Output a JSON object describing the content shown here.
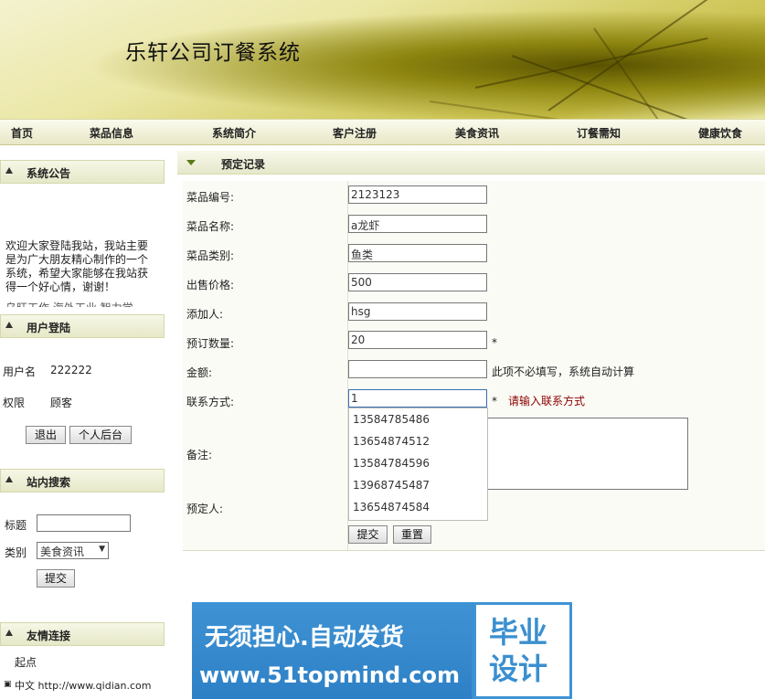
{
  "site_title": "乐轩公司订餐系统",
  "nav": [
    "首页",
    "菜品信息",
    "系统简介",
    "客户注册",
    "美食资讯",
    "订餐需知",
    "健康饮食"
  ],
  "left": {
    "notice": {
      "title": "系统公告",
      "text": "欢迎大家登陆我站，我站主要是为广大朋友精心制作的一个系统，希望大家能够在我站获得一个好心情，谢谢！",
      "cut_line": "乌旺工作   海外工业   智力学"
    },
    "login": {
      "title": "用户登陆",
      "username_label": "用户名",
      "username_value": "222222",
      "role_label": "权限",
      "role_value": "顾客",
      "logout_button": "退出",
      "personal_button": "个人后台"
    },
    "search": {
      "title": "站内搜索",
      "title_label": "标题",
      "category_label": "类别",
      "category_value": "美食资讯",
      "submit_button": "提交"
    },
    "links": {
      "title": "友情连接",
      "items": [
        "起点",
        "中文 http://www.qidian.com"
      ]
    }
  },
  "main": {
    "title": "预定记录",
    "fields": {
      "dish_no_label": "菜品编号:",
      "dish_no": "2123123",
      "dish_name_label": "菜品名称:",
      "dish_name": "a龙虾",
      "dish_cat_label": "菜品类别:",
      "dish_cat": "鱼类",
      "price_label": "出售价格:",
      "price": "500",
      "adder_label": "添加人:",
      "adder": "hsg",
      "qty_label": "预订数量:",
      "qty": "20",
      "qty_star": "*",
      "amount_label": "金额:",
      "amount": "",
      "amount_hint": "此项不必填写，系统自动计算",
      "contact_label": "联系方式:",
      "contact": "1",
      "contact_star": "*",
      "contact_hint": "请输入联系方式",
      "remark_label": "备注:",
      "booker_label": "预定人:"
    },
    "autocomplete": [
      "13584785486",
      "13654874512",
      "13584784596",
      "13968745487",
      "13654874584"
    ],
    "submit_button": "提交",
    "reset_button": "重置"
  },
  "ad": {
    "line1": "无须担心.自动发货",
    "line2": "www.51topmind.com",
    "right_text": "毕业设计"
  }
}
